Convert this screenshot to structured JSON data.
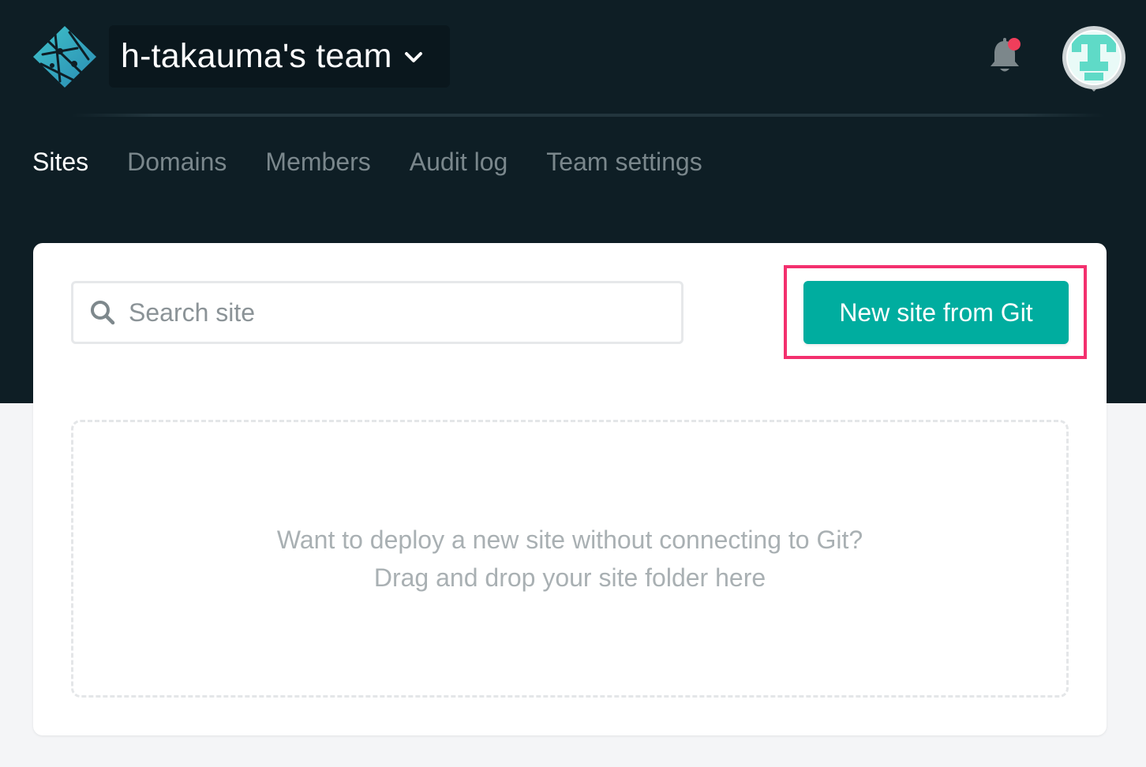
{
  "header": {
    "team_name": "h-takauma's team",
    "notification_badge_color": "#f03e5b",
    "icons": {
      "logo": "netlify-logo-icon",
      "team_dropdown": "chevron-down-icon",
      "notifications": "bell-icon",
      "avatar": "user-avatar"
    }
  },
  "nav": {
    "tabs": [
      {
        "label": "Sites",
        "active": true
      },
      {
        "label": "Domains",
        "active": false
      },
      {
        "label": "Members",
        "active": false
      },
      {
        "label": "Audit log",
        "active": false
      },
      {
        "label": "Team settings",
        "active": false
      }
    ]
  },
  "main": {
    "search": {
      "placeholder": "Search site",
      "value": "",
      "icon": "search-icon"
    },
    "new_site_button": {
      "label": "New site from Git",
      "highlight_color": "#f3306e",
      "color": "#00ad9f"
    },
    "dropzone": {
      "line1": "Want to deploy a new site without connecting to Git?",
      "line2": "Drag and drop your site folder here"
    }
  },
  "colors": {
    "header_bg": "#0e1e25",
    "accent": "#00ad9f",
    "page_bg": "#f4f5f7"
  }
}
